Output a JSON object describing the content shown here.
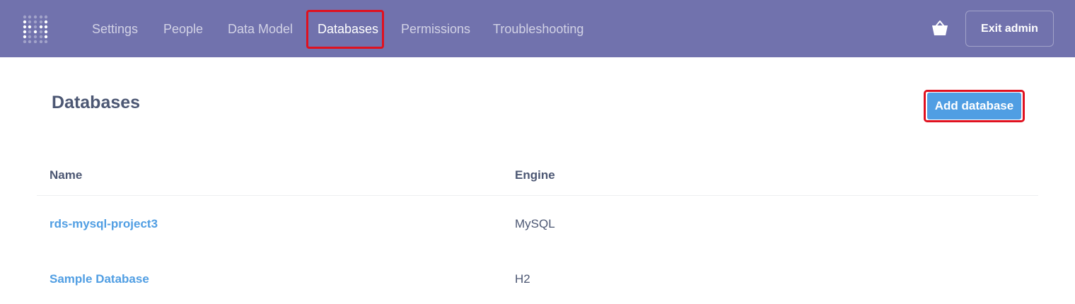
{
  "nav": {
    "items": [
      {
        "label": "Settings"
      },
      {
        "label": "People"
      },
      {
        "label": "Data Model"
      },
      {
        "label": "Databases"
      },
      {
        "label": "Permissions"
      },
      {
        "label": "Troubleshooting"
      }
    ],
    "active": "Databases",
    "exit_label": "Exit admin",
    "logo_icon": "metabase-logo-icon",
    "cart_icon": "basket-icon"
  },
  "page": {
    "title": "Databases",
    "add_button_label": "Add database"
  },
  "table": {
    "columns": [
      "Name",
      "Engine"
    ],
    "rows": [
      {
        "name": "rds-mysql-project3",
        "engine": "MySQL"
      },
      {
        "name": "Sample Database",
        "engine": "H2"
      }
    ]
  },
  "colors": {
    "nav_bg": "#7172ad",
    "accent": "#509ee3",
    "text_dark": "#4c5773",
    "highlight": "#e0111f"
  }
}
